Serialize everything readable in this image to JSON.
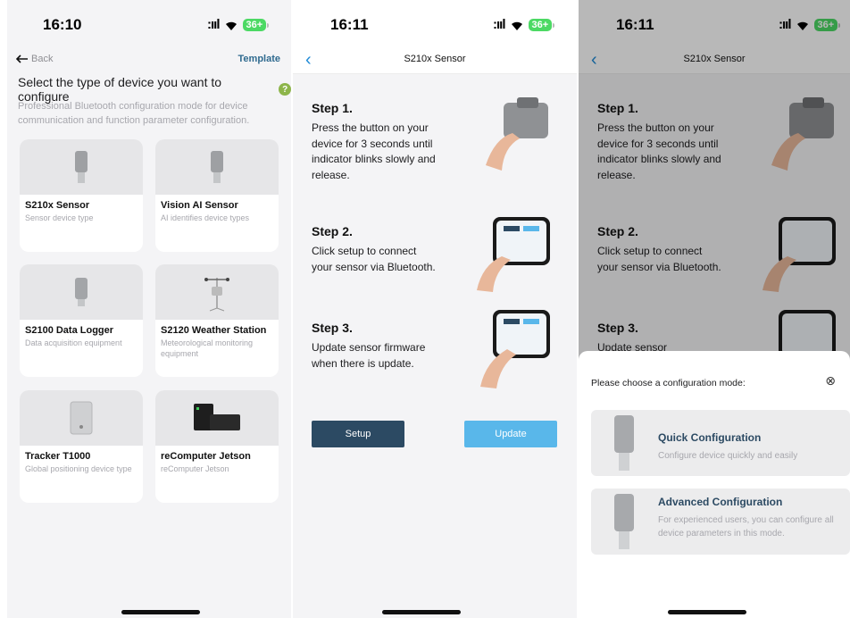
{
  "status": {
    "screen1_time": "16:10",
    "screen2_time": "16:11",
    "screen3_time": "16:11",
    "signal": ":ııl",
    "battery": "36+"
  },
  "screen1": {
    "back_label": "Back",
    "template_label": "Template",
    "title": "Select the type of device you want to configure",
    "help_icon": "?",
    "subtitle": "Professional Bluetooth configuration mode for device communication and function parameter configuration.",
    "cards": [
      {
        "name": "S210x Sensor",
        "desc": "Sensor device type"
      },
      {
        "name": "Vision AI Sensor",
        "desc": "AI identifies device types"
      },
      {
        "name": "S2100 Data Logger",
        "desc": "Data acquisition equipment"
      },
      {
        "name": "S2120 Weather Station",
        "desc": "Meteorological monitoring equipment"
      },
      {
        "name": "Tracker T1000",
        "desc": "Global positioning device type"
      },
      {
        "name": "reComputer Jetson",
        "desc": "reComputer Jetson"
      }
    ]
  },
  "screen2": {
    "title": "S210x Sensor",
    "steps": [
      {
        "heading": "Step 1.",
        "text": "Press the button on your device for 3 seconds until indicator blinks slowly and release."
      },
      {
        "heading": "Step 2.",
        "text": "Click setup to connect your sensor via Bluetooth."
      },
      {
        "heading": "Step 3.",
        "text": "Update sensor firmware when there is update."
      }
    ],
    "setup_label": "Setup",
    "update_label": "Update"
  },
  "screen3": {
    "title": "S210x Sensor",
    "steps": [
      {
        "heading": "Step 1.",
        "text": "Press the button on your device for 3 seconds until indicator blinks slowly and release."
      },
      {
        "heading": "Step 2.",
        "text": "Click setup to connect your sensor via Bluetooth."
      },
      {
        "heading": "Step 3.",
        "text": "Update sensor"
      }
    ],
    "sheet": {
      "prompt": "Please choose a configuration mode:",
      "close_icon": "⊗",
      "options": [
        {
          "title": "Quick Configuration",
          "desc": "Configure device quickly and easily"
        },
        {
          "title": "Advanced Configuration",
          "desc": "For experienced users, you can configure all device parameters in this mode."
        }
      ]
    }
  },
  "colors": {
    "accent_dark": "#2c4a63",
    "accent_light": "#59b7ea",
    "link_blue": "#1f8ad6",
    "help_green": "#8db54a",
    "battery_green": "#4cd964"
  },
  "icons": [
    "back-arrow-icon",
    "help-icon",
    "chevron-left-icon",
    "wifi-icon",
    "battery-icon",
    "close-circle-icon"
  ]
}
